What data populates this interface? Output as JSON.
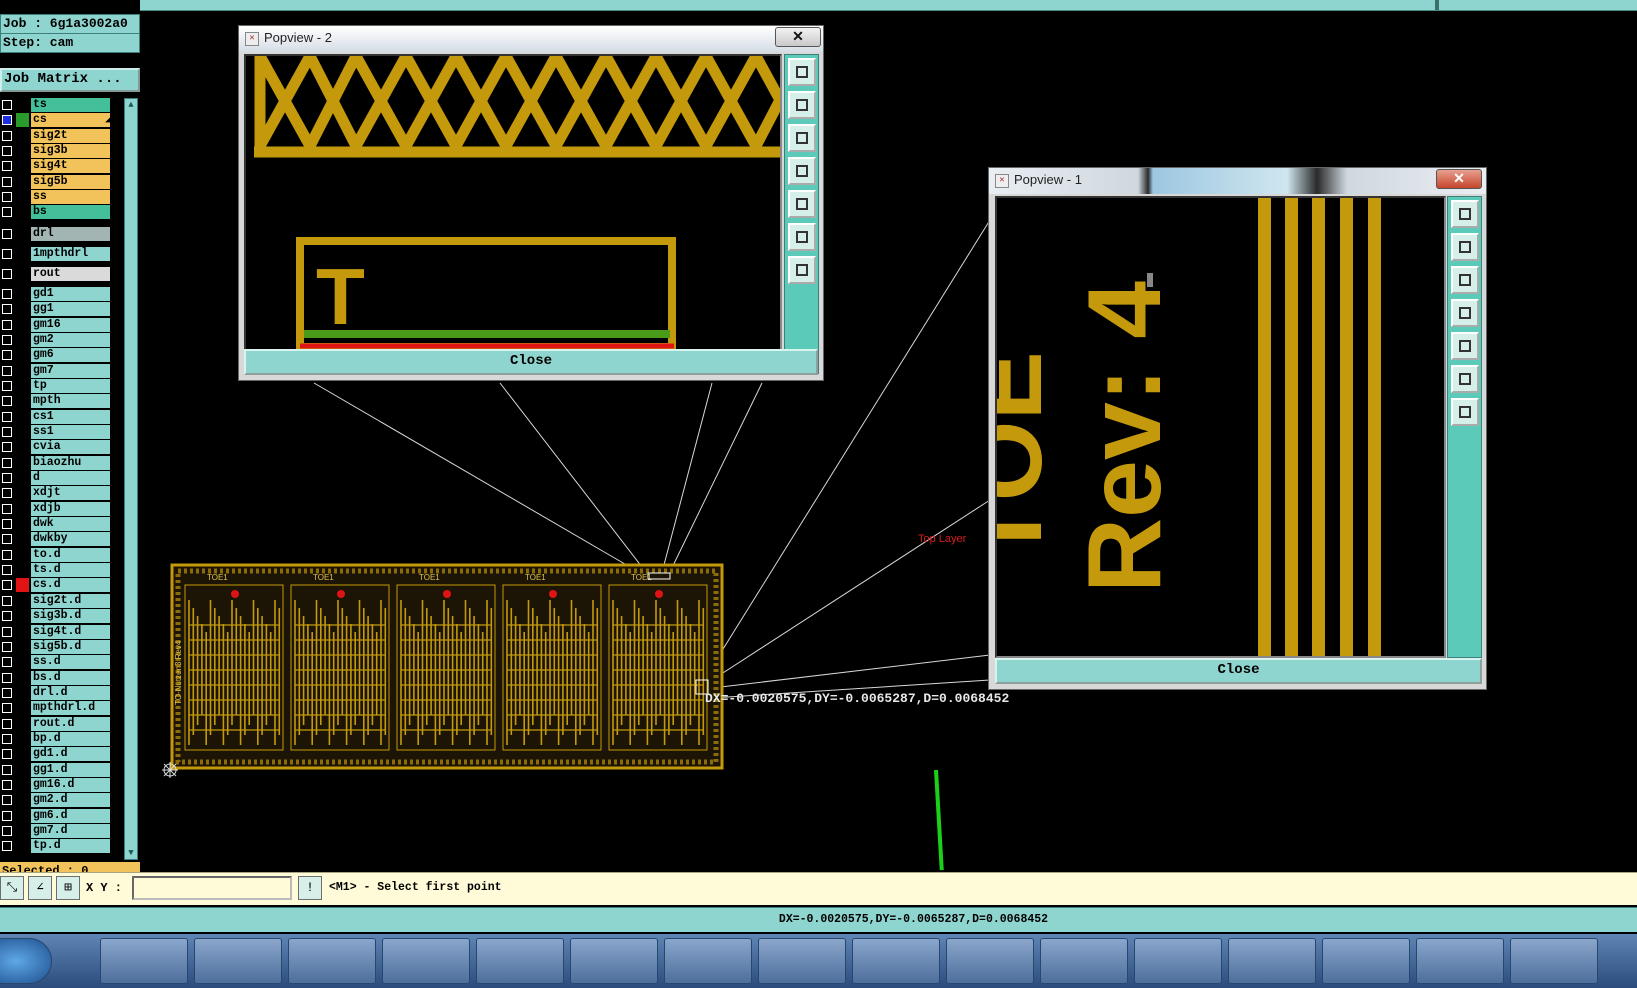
{
  "job": {
    "label": "Job : 6g1a3002a0",
    "step": "Step: cam",
    "matrix_button": "Job Matrix ..."
  },
  "layers": [
    {
      "name": "ts",
      "bg": "#43c09a",
      "mark": "◢",
      "row": 0
    },
    {
      "name": "cs",
      "bg": "#f2c35a",
      "mark": "◢≡",
      "swatch": "#2a9a2a",
      "checked": true,
      "row": 1
    },
    {
      "name": "sig2t",
      "bg": "#f2c35a",
      "mark": "",
      "row": 2
    },
    {
      "name": "sig3b",
      "bg": "#f2c35a",
      "mark": "",
      "row": 3
    },
    {
      "name": "sig4t",
      "bg": "#f2c35a",
      "mark": "",
      "row": 4
    },
    {
      "name": "sig5b",
      "bg": "#f2c35a",
      "mark": "◢",
      "row": 5
    },
    {
      "name": "ss",
      "bg": "#f2c35a",
      "mark": "◢",
      "row": 6
    },
    {
      "name": "bs",
      "bg": "#43c09a",
      "mark": "",
      "row": 7
    },
    {
      "name": "drl",
      "bg": "#a3b5b3",
      "mark": "",
      "row": 8.4
    },
    {
      "name": "1mpthdrl",
      "bg": "#8fd5cf",
      "mark": "",
      "row": 9.7
    },
    {
      "name": "rout",
      "bg": "#dadada",
      "mark": "",
      "row": 11
    },
    {
      "name": "gd1",
      "bg": "#8fd5cf",
      "mark": "◢",
      "row": 12.3
    },
    {
      "name": "gg1",
      "bg": "#8fd5cf",
      "mark": "",
      "row": 13.3
    },
    {
      "name": "gm16",
      "bg": "#8fd5cf",
      "mark": "◢",
      "row": 14.3
    },
    {
      "name": "gm2",
      "bg": "#8fd5cf",
      "mark": "",
      "row": 15.3
    },
    {
      "name": "gm6",
      "bg": "#8fd5cf",
      "mark": "",
      "row": 16.3
    },
    {
      "name": "gm7",
      "bg": "#8fd5cf",
      "mark": "",
      "row": 17.3
    },
    {
      "name": "tp",
      "bg": "#8fd5cf",
      "mark": "◢",
      "row": 18.3
    },
    {
      "name": "mpth",
      "bg": "#8fd5cf",
      "mark": "",
      "row": 19.3
    },
    {
      "name": "cs1",
      "bg": "#8fd5cf",
      "mark": "",
      "row": 20.3
    },
    {
      "name": "ss1",
      "bg": "#8fd5cf",
      "mark": "",
      "row": 21.3
    },
    {
      "name": "cvia",
      "bg": "#8fd5cf",
      "mark": "",
      "row": 22.3
    },
    {
      "name": "biaozhu",
      "bg": "#8fd5cf",
      "mark": "",
      "row": 23.3
    },
    {
      "name": "d",
      "bg": "#8fd5cf",
      "mark": "",
      "row": 24.3
    },
    {
      "name": "xdjt",
      "bg": "#8fd5cf",
      "mark": "",
      "row": 25.3
    },
    {
      "name": "xdjb",
      "bg": "#8fd5cf",
      "mark": "",
      "row": 26.3
    },
    {
      "name": "dwk",
      "bg": "#8fd5cf",
      "mark": "",
      "row": 27.3
    },
    {
      "name": "dwkby",
      "bg": "#8fd5cf",
      "mark": "",
      "row": 28.3
    },
    {
      "name": "to.d",
      "bg": "#8fd5cf",
      "mark": "◢",
      "row": 29.3
    },
    {
      "name": "ts.d",
      "bg": "#8fd5cf",
      "mark": "◢",
      "row": 30.3
    },
    {
      "name": "cs.d",
      "bg": "#8fd5cf",
      "mark": "◢",
      "swatch": "#e01414",
      "row": 31.3
    },
    {
      "name": "sig2t.d",
      "bg": "#8fd5cf",
      "mark": "",
      "row": 32.3
    },
    {
      "name": "sig3b.d",
      "bg": "#8fd5cf",
      "mark": "",
      "row": 33.3
    },
    {
      "name": "sig4t.d",
      "bg": "#8fd5cf",
      "mark": "",
      "row": 34.3
    },
    {
      "name": "sig5b.d",
      "bg": "#8fd5cf",
      "mark": "◢",
      "row": 35.3
    },
    {
      "name": "ss.d",
      "bg": "#8fd5cf",
      "mark": "◢",
      "row": 36.3
    },
    {
      "name": "bs.d",
      "bg": "#8fd5cf",
      "mark": "",
      "row": 37.3
    },
    {
      "name": "drl.d",
      "bg": "#8fd5cf",
      "mark": "",
      "row": 38.3
    },
    {
      "name": "mpthdrl.d",
      "bg": "#8fd5cf",
      "mark": "",
      "row": 39.3
    },
    {
      "name": "rout.d",
      "bg": "#8fd5cf",
      "mark": "",
      "row": 40.3
    },
    {
      "name": "bp.d",
      "bg": "#8fd5cf",
      "mark": "",
      "row": 41.3
    },
    {
      "name": "gd1.d",
      "bg": "#8fd5cf",
      "mark": "◢",
      "row": 42.3
    },
    {
      "name": "gg1.d",
      "bg": "#8fd5cf",
      "mark": "",
      "row": 43.3
    },
    {
      "name": "gm16.d",
      "bg": "#8fd5cf",
      "mark": "◢",
      "row": 44.3
    },
    {
      "name": "gm2.d",
      "bg": "#8fd5cf",
      "mark": "",
      "row": 45.3
    },
    {
      "name": "gm6.d",
      "bg": "#8fd5cf",
      "mark": "",
      "row": 46.3
    },
    {
      "name": "gm7.d",
      "bg": "#8fd5cf",
      "mark": "",
      "row": 47.3
    },
    {
      "name": "tp.d",
      "bg": "#8fd5cf",
      "mark": "◢",
      "row": 48.3
    }
  ],
  "selected": "Selected : 0",
  "popview2": {
    "title": "Popview - 2",
    "close": "Close",
    "glyph": "T"
  },
  "popview1": {
    "title": "Popview - 1",
    "close": "Close",
    "rev": "Rev: 4",
    "partial": "TOE"
  },
  "canvas": {
    "top_layer_label": "Top Layer",
    "measure": "DX=-0.0020575,DY=-0.0065287,D=0.0068452",
    "board_label": "TOE1",
    "side_label": "TO-Nutzen3  Rev4"
  },
  "command": {
    "xy_label": "X Y :",
    "prompt": "<M1> - Select first point",
    "xy_value": ""
  },
  "status": "DX=-0.0020575,DY=-0.0065287,D=0.0068452",
  "colors": {
    "copper": "#c49a0c",
    "teal": "#8fd5cf",
    "green_arrow": "#19d119"
  },
  "icons": [
    "zoom-icon",
    "measure-icon",
    "grid-icon",
    "alert-icon"
  ]
}
